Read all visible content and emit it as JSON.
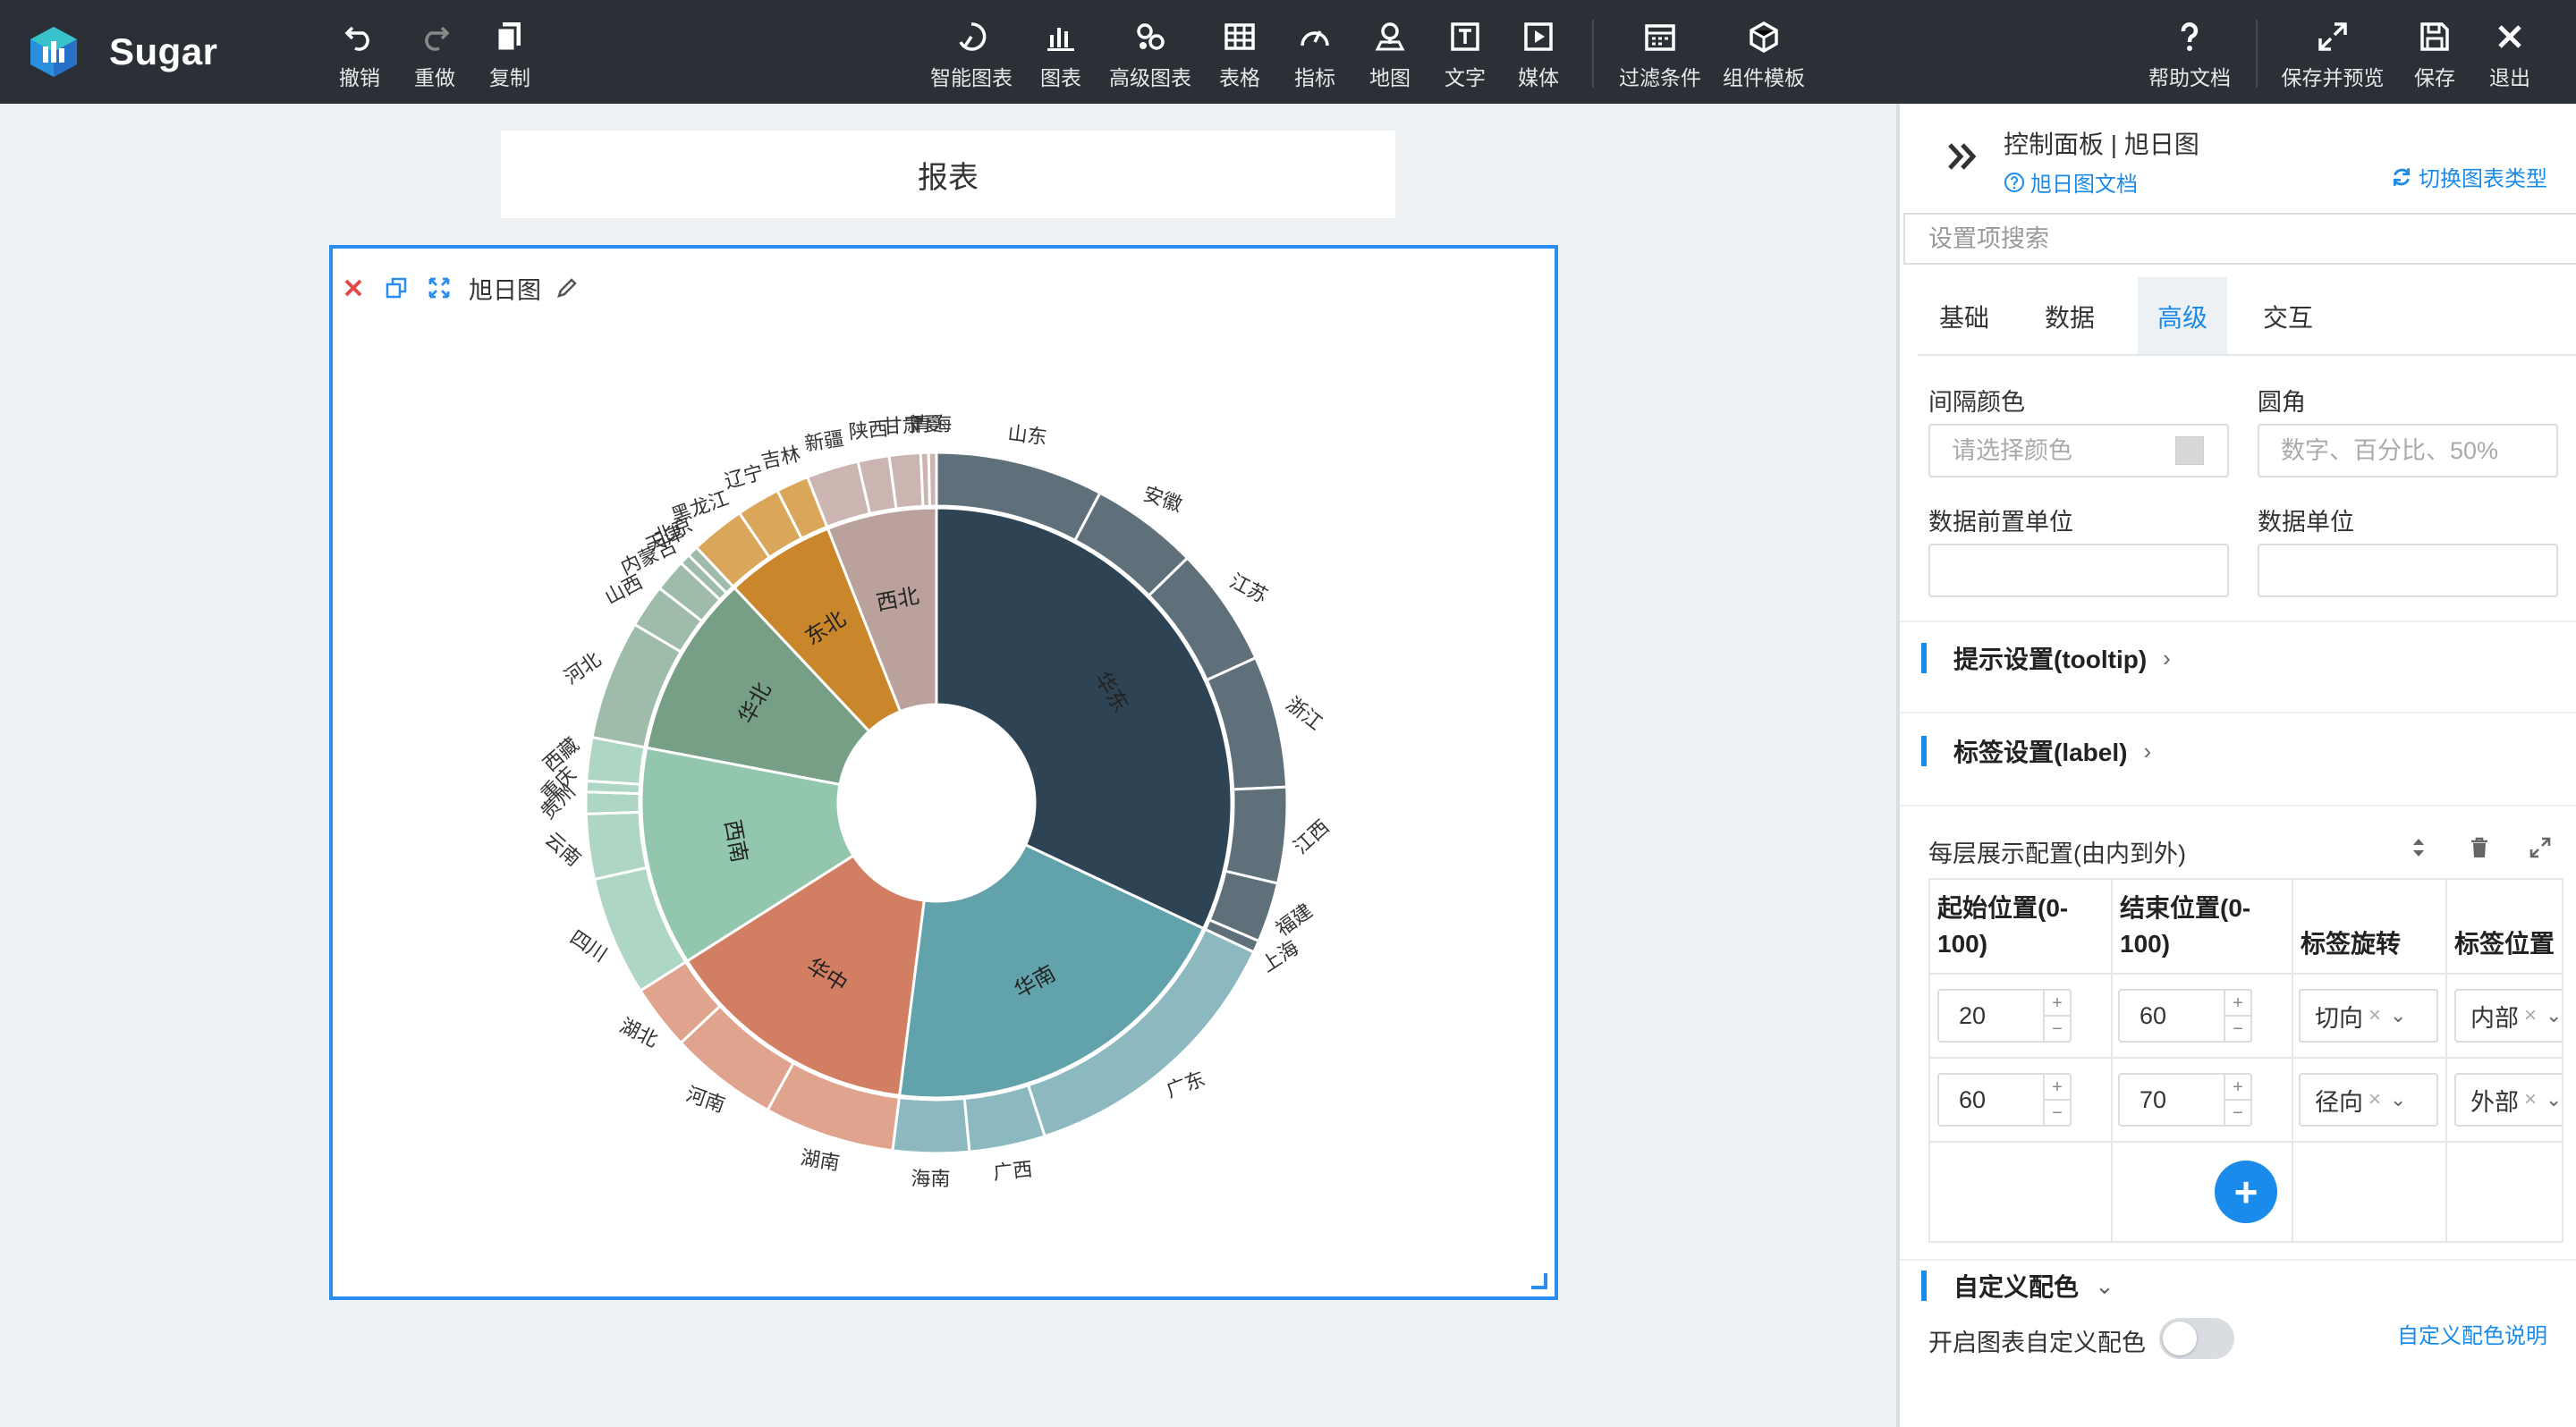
{
  "app": {
    "name": "Sugar"
  },
  "toolbar": {
    "undo": "撤销",
    "redo": "重做",
    "copy": "复制",
    "smart_chart": "智能图表",
    "chart": "图表",
    "advanced_chart": "高级图表",
    "table": "表格",
    "indicator": "指标",
    "map": "地图",
    "text": "文字",
    "media": "媒体",
    "filter": "过滤条件",
    "component_template": "组件模板",
    "help": "帮助文档",
    "save_preview": "保存并预览",
    "save": "保存",
    "exit": "退出"
  },
  "report": {
    "title": "报表"
  },
  "card": {
    "title": "旭日图"
  },
  "chart_data": {
    "type": "sunburst",
    "inner_ring": [
      {
        "name": "华东",
        "value": 32,
        "color": "#2e4454"
      },
      {
        "name": "华南",
        "value": 20,
        "color": "#62a2ab"
      },
      {
        "name": "华中",
        "value": 14,
        "color": "#d27e62"
      },
      {
        "name": "西南",
        "value": 12,
        "color": "#92c6ad"
      },
      {
        "name": "华北",
        "value": 10,
        "color": "#769f86"
      },
      {
        "name": "东北",
        "value": 6,
        "color": "#c9862a"
      },
      {
        "name": "西北",
        "value": 6,
        "color": "#bba19c"
      }
    ],
    "outer_ring": [
      {
        "name": "山东",
        "parent": "华东",
        "value": 7.0,
        "color": "#5f707b"
      },
      {
        "name": "安徽",
        "parent": "华东",
        "value": 4.5,
        "color": "#5f707b"
      },
      {
        "name": "江苏",
        "parent": "华东",
        "value": 5.0,
        "color": "#5f707b"
      },
      {
        "name": "浙江",
        "parent": "华东",
        "value": 5.5,
        "color": "#5f707b"
      },
      {
        "name": "江西",
        "parent": "华东",
        "value": 4.0,
        "color": "#5f707b"
      },
      {
        "name": "福建",
        "parent": "华东",
        "value": 2.5,
        "color": "#5f707b"
      },
      {
        "name": "上海",
        "parent": "华东",
        "value": 0.5,
        "color": "#5f707b"
      },
      {
        "name": "广东",
        "parent": "华南",
        "value": 13.0,
        "color": "#8bb9bf"
      },
      {
        "name": "广西",
        "parent": "华南",
        "value": 3.5,
        "color": "#8bb9bf"
      },
      {
        "name": "海南",
        "parent": "华南",
        "value": 3.5,
        "color": "#8bb9bf"
      },
      {
        "name": "湖南",
        "parent": "华中",
        "value": 6.0,
        "color": "#e0a38e"
      },
      {
        "name": "河南",
        "parent": "华中",
        "value": 5.0,
        "color": "#e0a38e"
      },
      {
        "name": "湖北",
        "parent": "华中",
        "value": 3.0,
        "color": "#e0a38e"
      },
      {
        "name": "四川",
        "parent": "西南",
        "value": 5.5,
        "color": "#add7c4"
      },
      {
        "name": "云南",
        "parent": "西南",
        "value": 3.0,
        "color": "#add7c4"
      },
      {
        "name": "贵州",
        "parent": "西南",
        "value": 1.0,
        "color": "#add7c4"
      },
      {
        "name": "重庆",
        "parent": "西南",
        "value": 0.5,
        "color": "#add7c4"
      },
      {
        "name": "西藏",
        "parent": "西南",
        "value": 2.0,
        "color": "#add7c4"
      },
      {
        "name": "河北",
        "parent": "华北",
        "value": 5.5,
        "color": "#9fbba9"
      },
      {
        "name": "山西",
        "parent": "华北",
        "value": 2.0,
        "color": "#9fbba9"
      },
      {
        "name": "内蒙古",
        "parent": "华北",
        "value": 1.5,
        "color": "#9fbba9"
      },
      {
        "name": "天津",
        "parent": "华北",
        "value": 0.5,
        "color": "#9fbba9"
      },
      {
        "name": "北京",
        "parent": "华北",
        "value": 0.5,
        "color": "#9fbba9"
      },
      {
        "name": "黑龙江",
        "parent": "东北",
        "value": 2.5,
        "color": "#daa75a"
      },
      {
        "name": "辽宁",
        "parent": "东北",
        "value": 2.0,
        "color": "#daa75a"
      },
      {
        "name": "吉林",
        "parent": "东北",
        "value": 1.5,
        "color": "#daa75a"
      },
      {
        "name": "新疆",
        "parent": "西北",
        "value": 2.0,
        "color": "#ccb5b0"
      },
      {
        "name": "陕西",
        "parent": "西北",
        "value": 1.2,
        "color": "#ccb5b0"
      },
      {
        "name": "甘肃",
        "parent": "西北",
        "value": 1.2,
        "color": "#ccb5b0"
      },
      {
        "name": "宁夏",
        "parent": "西北",
        "value": 0.3,
        "color": "#ccb5b0"
      },
      {
        "name": "青海",
        "parent": "西北",
        "value": 0.3,
        "color": "#ccb5b0"
      }
    ]
  },
  "panel": {
    "title": "控制面板 | 旭日图",
    "doc_link": "旭日图文档",
    "switch_link": "切换图表类型",
    "search_placeholder": "设置项搜索",
    "tabs": [
      "基础",
      "数据",
      "高级",
      "交互"
    ],
    "active_tab": "高级",
    "gap_color_label": "间隔颜色",
    "gap_color_placeholder": "请选择颜色",
    "radius_label": "圆角",
    "radius_placeholder": "数字、百分比、50%",
    "prefix_label": "数据前置单位",
    "unit_label": "数据单位",
    "tooltip_section": "提示设置(tooltip)",
    "label_section": "标签设置(label)",
    "layer_config_label": "每层展示配置(由内到外)",
    "table": {
      "headers": [
        "起始位置(0-100)",
        "结束位置(0-100)",
        "标签旋转",
        "标签位置"
      ],
      "rows": [
        {
          "start": "20",
          "end": "60",
          "rotate": "切向",
          "position": "内部"
        },
        {
          "start": "60",
          "end": "70",
          "rotate": "径向",
          "position": "外部"
        }
      ]
    },
    "custom_color_section": "自定义配色",
    "custom_color_toggle_label": "开启图表自定义配色",
    "custom_color_help": "自定义配色说明"
  }
}
